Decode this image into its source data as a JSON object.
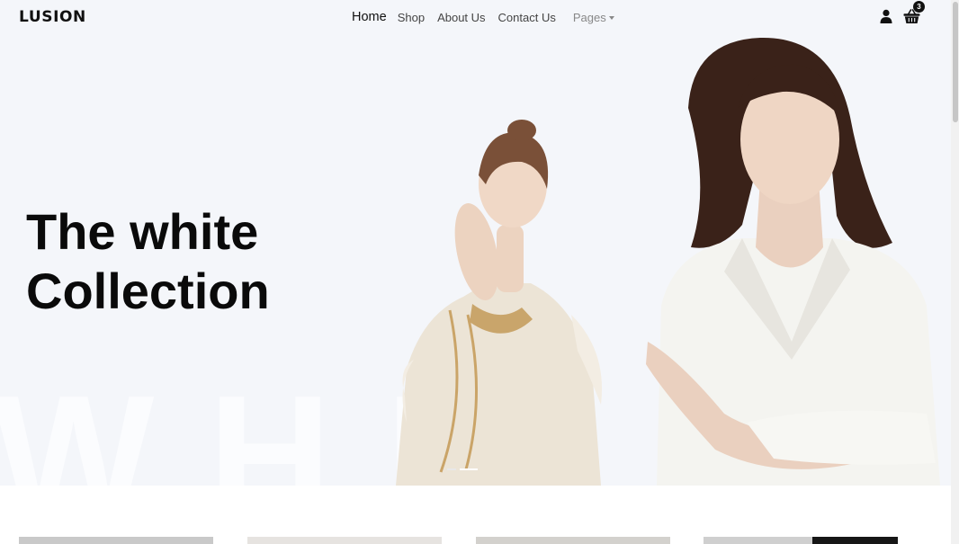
{
  "brand": {
    "logo": "LUSION"
  },
  "nav": {
    "items": [
      {
        "label": "Home",
        "active": true
      },
      {
        "label": "Shop",
        "active": false
      },
      {
        "label": "About Us",
        "active": false
      },
      {
        "label": "Contact Us",
        "active": false
      }
    ],
    "pages_label": "Pages"
  },
  "header_icons": {
    "user": "user-icon",
    "cart": "cart-icon",
    "cart_count": "3"
  },
  "hero": {
    "title_line1": "The white",
    "title_line2": "Collection",
    "background_letters": "WHI",
    "slider": {
      "count": 2,
      "active": 1
    }
  },
  "products": {
    "visible_cards": 4
  },
  "colors": {
    "hero_bg": "#f4f6fa",
    "text": "#0a0a0a",
    "accent": "#111111"
  }
}
